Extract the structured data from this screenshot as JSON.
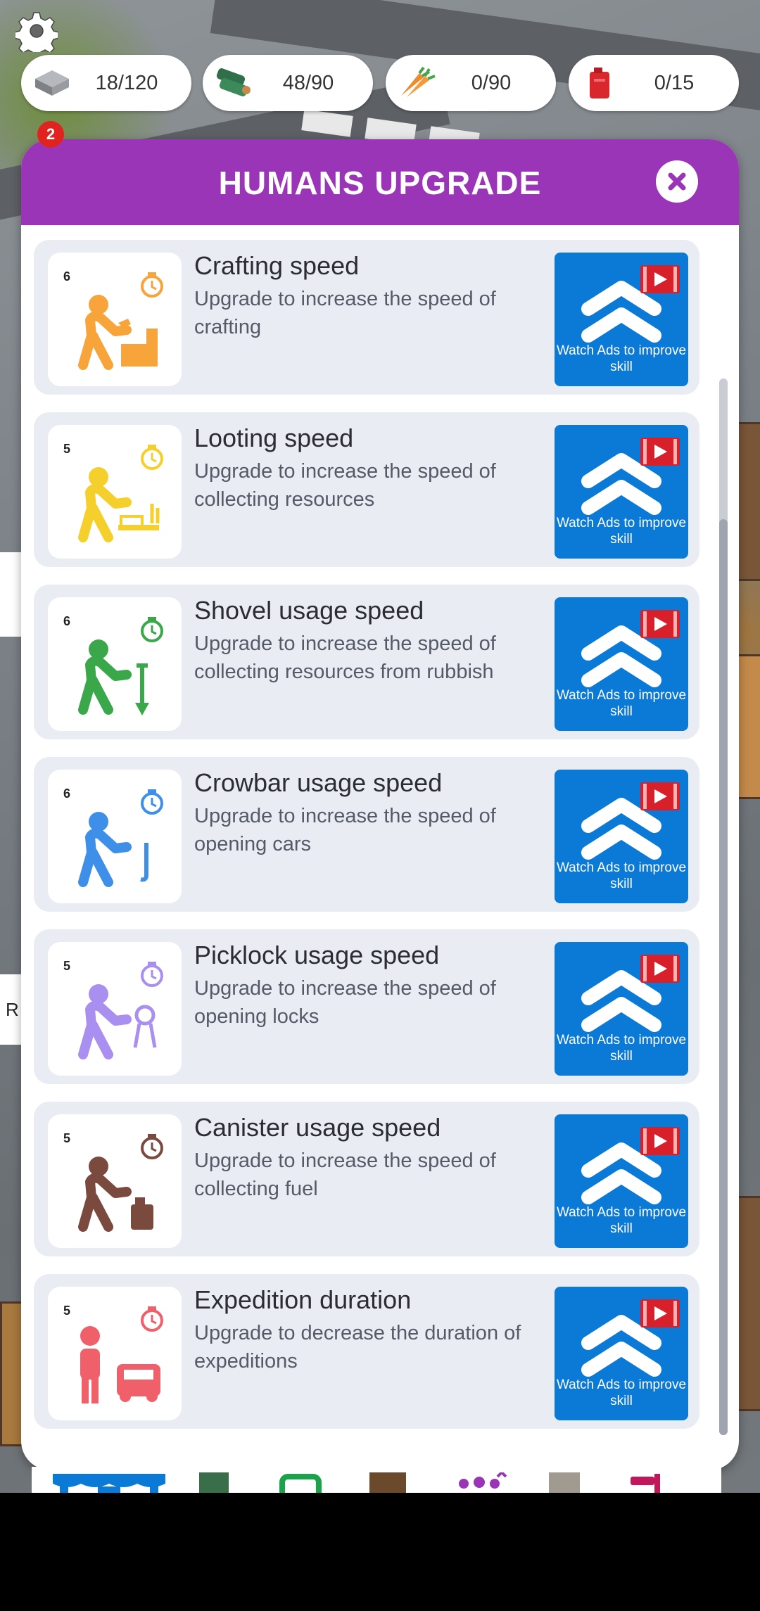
{
  "resources": [
    {
      "icon": "stone-brick-icon",
      "value": "18/120"
    },
    {
      "icon": "wood-log-icon",
      "value": "48/90"
    },
    {
      "icon": "carrot-food-icon",
      "value": "0/90"
    },
    {
      "icon": "fuel-canister-icon",
      "value": "0/15"
    }
  ],
  "notification_badge": "2",
  "panel": {
    "title": "HUMANS UPGRADE",
    "close_icon": "close-icon"
  },
  "upgrades": [
    {
      "level": "6",
      "title": "Crafting speed",
      "description": "Upgrade to increase the speed of crafting",
      "color": "#f7a43a",
      "button": "Watch Ads to improve skill"
    },
    {
      "level": "5",
      "title": "Looting speed",
      "description": "Upgrade to increase the speed of collecting resources",
      "color": "#f5d02d",
      "button": "Watch Ads to improve skill"
    },
    {
      "level": "6",
      "title": "Shovel usage speed",
      "description": "Upgrade to increase the speed of collecting resources from rubbish",
      "color": "#3aa84a",
      "button": "Watch Ads to improve skill"
    },
    {
      "level": "6",
      "title": "Crowbar usage speed",
      "description": "Upgrade to increase the speed of opening cars",
      "color": "#3d8fe8",
      "button": "Watch Ads to improve skill"
    },
    {
      "level": "5",
      "title": "Picklock usage speed",
      "description": "Upgrade to increase the speed of opening locks",
      "color": "#a98ff0",
      "button": "Watch Ads to improve skill"
    },
    {
      "level": "5",
      "title": "Canister usage speed",
      "description": "Upgrade to increase the speed of collecting fuel",
      "color": "#7a4a3e",
      "button": "Watch Ads to improve skill"
    },
    {
      "level": "5",
      "title": "Expedition duration",
      "description": "Upgrade to decrease the duration of expeditions",
      "color": "#f0606a",
      "button": "Watch Ads to improve skill"
    }
  ],
  "side_label": "R",
  "colors": {
    "header": "#9b35b8",
    "ad_button": "#0a7ad6",
    "ad_play": "#d8202a",
    "card_bg": "#e9ecf3"
  }
}
